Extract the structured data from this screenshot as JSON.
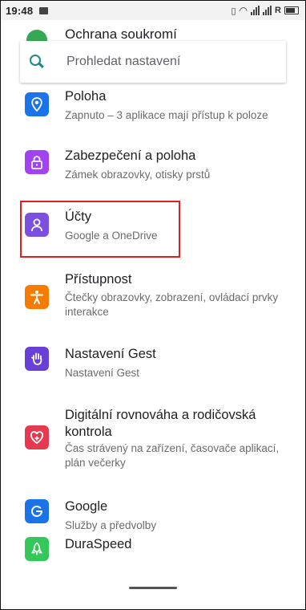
{
  "status_bar": {
    "time": "19:48",
    "right_text": "R"
  },
  "top_item": {
    "title": "Ochrana soukromí"
  },
  "search": {
    "placeholder": "Prohledat nastavení"
  },
  "items": [
    {
      "title": "Poloha",
      "subtitle": "Zapnuto – 3 aplikace mají přístup k poloze",
      "icon": "location-icon",
      "color": "#1a73e8"
    },
    {
      "title": "Zabezpečení a poloha",
      "subtitle": "Zámek obrazovky, otisky prstů",
      "icon": "lock-icon",
      "color": "#a142f4"
    },
    {
      "title": "Účty",
      "subtitle": "Google a OneDrive",
      "icon": "account-icon",
      "color": "#7b4fe0"
    },
    {
      "title": "Přístupnost",
      "subtitle": "Čtečky obrazovky, zobrazení, ovládací prvky interakce",
      "icon": "accessibility-icon",
      "color": "#f57c00"
    },
    {
      "title": "Nastavení Gest",
      "subtitle": "Nastavení Gest",
      "icon": "gesture-hand-icon",
      "color": "#6a3fd6"
    },
    {
      "title": "Digitální rovnováha a rodičovská kontrola",
      "subtitle": "Čas strávený na zařízení, časovače aplikací, plán večerky",
      "icon": "heart-plus-icon",
      "color": "#e53950"
    },
    {
      "title": "Google",
      "subtitle": "Služby a předvolby",
      "icon": "google-g-icon",
      "color": "#1a73e8"
    },
    {
      "title": "DuraSpeed",
      "subtitle": "",
      "icon": "rocket-icon",
      "color": "#34c759"
    }
  ]
}
